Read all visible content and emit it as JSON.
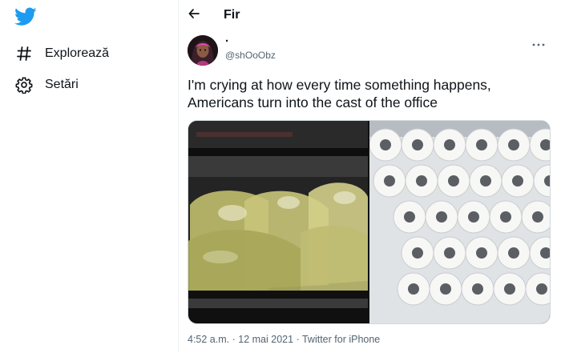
{
  "sidebar": {
    "logo_icon": "twitter-bird-icon",
    "items": [
      {
        "icon": "hashtag-icon",
        "label": "Explorează"
      },
      {
        "icon": "gear-icon",
        "label": "Setări"
      }
    ]
  },
  "header": {
    "back_icon": "back-arrow-icon",
    "title": "Fir"
  },
  "tweet": {
    "author_name": "·",
    "author_handle": "@shOoObz",
    "more_icon": "more-options-icon",
    "text": "I'm crying at how every time something happens, Americans turn into the cast of the office",
    "media": [
      {
        "name": "bags-of-liquid-image"
      },
      {
        "name": "toilet-paper-rolls-image"
      }
    ],
    "time": "4:52 a.m.",
    "separator": "·",
    "date": "12 mai 2021",
    "source": "Twitter for iPhone"
  },
  "colors": {
    "brand": "#1d9bf0",
    "text_primary": "#0f1419",
    "text_secondary": "#536471",
    "border": "#eff3f4"
  }
}
